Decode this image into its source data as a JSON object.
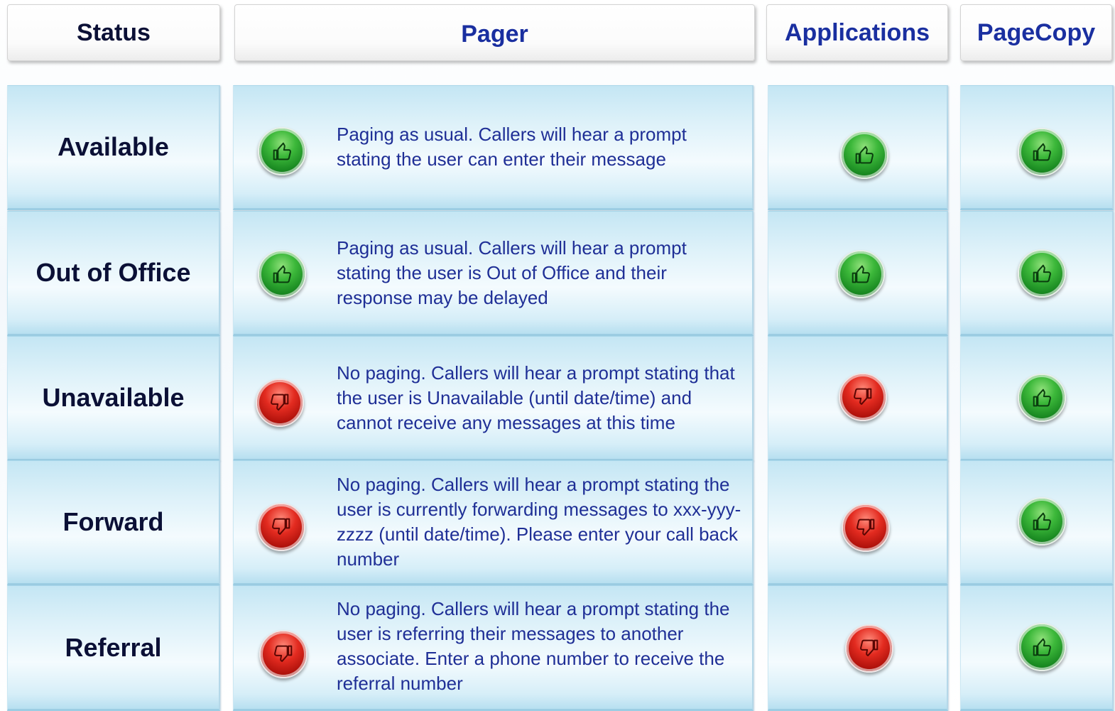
{
  "headers": {
    "status": "Status",
    "pager": "Pager",
    "applications": "Applications",
    "pagecopy": "PageCopy"
  },
  "colors": {
    "status_header_text": "#0b1036",
    "header_text_blue": "#1a2fa0",
    "description_text": "#1f2f96",
    "cell_light_blue": "#ddf1f9",
    "thumbs_up_green": "#1a8a22",
    "thumbs_down_red": "#b0120c"
  },
  "icons": {
    "allowed": "thumbs-up-icon",
    "blocked": "thumbs-down-icon"
  },
  "rows": [
    {
      "status": "Available",
      "pager": "up",
      "pager_desc": "Paging as usual.  Callers will hear a prompt stating the user can enter their message",
      "applications": "up",
      "pagecopy": "up"
    },
    {
      "status": "Out of Office",
      "pager": "up",
      "pager_desc": "Paging as usual.  Callers will hear a prompt stating the user is Out of Office and their response may be delayed",
      "applications": "up",
      "pagecopy": "up"
    },
    {
      "status": "Unavailable",
      "pager": "down",
      "pager_desc": "No paging.  Callers will hear a prompt stating that the user is Unavailable (until date/time) and cannot receive any messages at this time",
      "applications": "down",
      "pagecopy": "up"
    },
    {
      "status": "Forward",
      "pager": "down",
      "pager_desc": "No paging.  Callers will hear a prompt stating the user is currently forwarding messages to xxx-yyy-zzzz (until date/time).  Please enter your call back number",
      "applications": "down",
      "pagecopy": "up"
    },
    {
      "status": "Referral",
      "pager": "down",
      "pager_desc": "No paging.  Callers will hear a prompt stating the user is referring their messages to another associate.  Enter a phone number to receive the referral number",
      "applications": "down",
      "pagecopy": "up"
    }
  ]
}
